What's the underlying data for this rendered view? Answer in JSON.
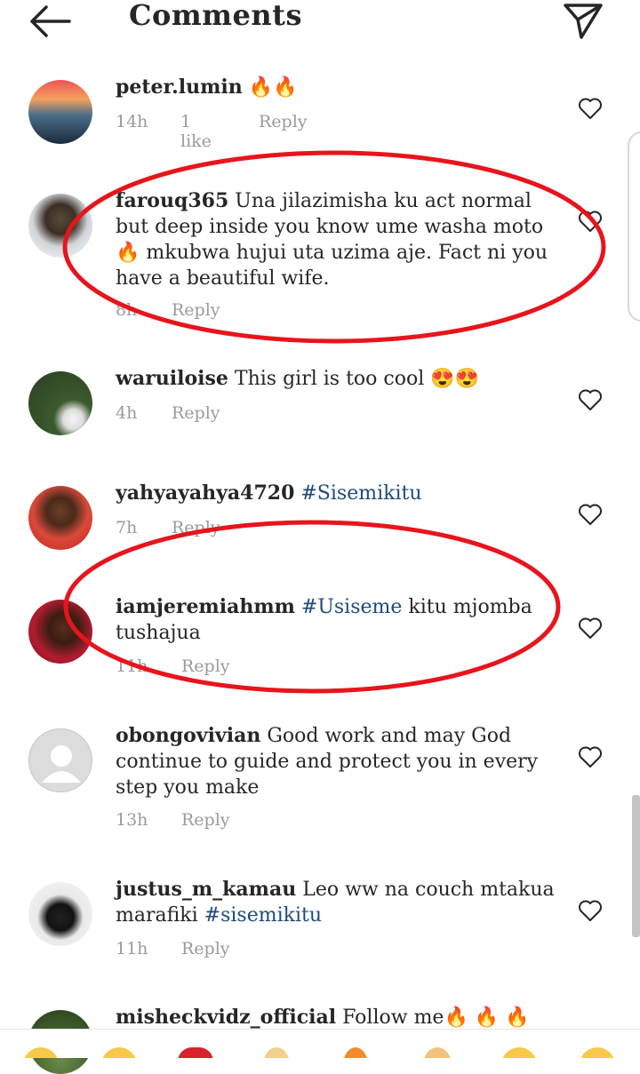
{
  "header": {
    "title": "Comments",
    "back_icon": "arrow-left-icon",
    "send_icon": "paper-plane-icon"
  },
  "comments": [
    {
      "user": "peter.lumin",
      "text": "🔥🔥",
      "tag": "",
      "time": "14h",
      "likes": "1 like",
      "reply": "Reply"
    },
    {
      "user": "farouq365",
      "text": "Una jilazimisha ku act normal but deep inside you know ume washa moto 🔥 mkubwa hujui uta uzima aje. Fact ni you have a beautiful wife.",
      "tag": "",
      "time": "8h",
      "likes": "",
      "reply": "Reply"
    },
    {
      "user": "waruiloise",
      "text": "This girl is too cool 😍😍",
      "tag": "",
      "time": "4h",
      "likes": "",
      "reply": "Reply"
    },
    {
      "user": "yahyayahya4720",
      "text": "",
      "tag": "#Sisemikitu",
      "time": "7h",
      "likes": "",
      "reply": "Reply"
    },
    {
      "user": "iamjeremiahmm",
      "text_pre": "",
      "tag": "#Usiseme",
      "text": "kitu mjomba tushajua",
      "time": "11h",
      "likes": "",
      "reply": "Reply"
    },
    {
      "user": "obongovivian",
      "text": "Good work and may God continue to  guide and protect you in every step you make",
      "tag": "",
      "time": "13h",
      "likes": "",
      "reply": "Reply"
    },
    {
      "user": "justus_m_kamau",
      "text": "Leo ww na couch mtakua marafiki",
      "tag": "#sisemikitu",
      "time": "11h",
      "likes": "",
      "reply": "Reply"
    },
    {
      "user": "misheckvidz_official",
      "text": "Follow me🔥 🔥 🔥",
      "tag": "",
      "time": "",
      "likes": "",
      "reply": ""
    }
  ],
  "colors": {
    "text": "#262626",
    "meta": "#9a9a9a",
    "hashtag": "#1f4a7a",
    "annotation": "#e8141c"
  }
}
